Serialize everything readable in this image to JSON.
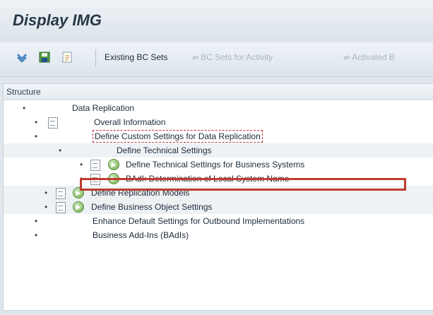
{
  "window": {
    "title": "Display IMG"
  },
  "toolbar": {
    "icons": [
      "tree-expand-icon",
      "save-icon",
      "document-icon"
    ],
    "existing_bc_sets": "Existing BC Sets",
    "bc_sets_for_activity": "BC Sets for Activity",
    "activated_bc_sets": "Activated B"
  },
  "tree": {
    "header": "Structure",
    "rows": [
      {
        "label": "Data Replication",
        "expander": "•",
        "icons": []
      },
      {
        "label": "Overall Information",
        "expander": "•",
        "icons": [
          "document-icon"
        ]
      },
      {
        "label": "Define Custom Settings for Data Replication",
        "expander": "•",
        "icons": [],
        "focused": true
      },
      {
        "label": "Define Technical Settings",
        "expander": "•",
        "icons": []
      },
      {
        "label": "Define Technical Settings for Business Systems",
        "expander": "•",
        "icons": [
          "document-icon",
          "execute-icon"
        ],
        "selected": true
      },
      {
        "label": "BAdI: Determination of Local System Name",
        "expander": "•",
        "icons": [
          "document-icon",
          "execute-icon"
        ]
      },
      {
        "label": "Define Replication Models",
        "expander": "•",
        "icons": [
          "document-icon",
          "execute-icon"
        ]
      },
      {
        "label": "Define Business Object Settings",
        "expander": "•",
        "icons": [
          "document-icon",
          "execute-icon"
        ]
      },
      {
        "label": "Enhance Default Settings for Outbound Implementations",
        "expander": "•",
        "icons": []
      },
      {
        "label": "Business Add-Ins (BAdIs)",
        "expander": "•",
        "icons": []
      }
    ]
  }
}
